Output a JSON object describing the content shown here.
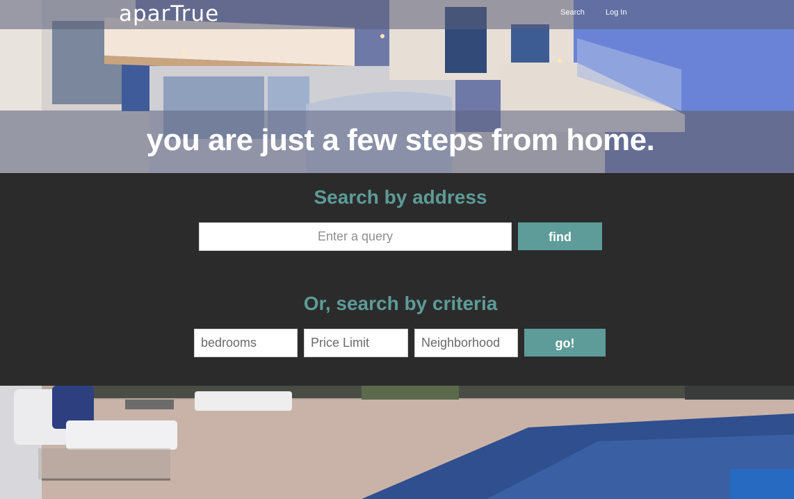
{
  "brand": {
    "logo_text": "aparTrue"
  },
  "nav": {
    "search_label": "Search",
    "login_label": "Log In"
  },
  "hero": {
    "tagline": "you are just a few steps from home."
  },
  "address_search": {
    "title": "Search by address",
    "query_placeholder": "Enter a query",
    "find_label": "find"
  },
  "criteria_search": {
    "title": "Or, search by criteria",
    "bedrooms_placeholder": "bedrooms",
    "price_placeholder": "Price Limit",
    "neighborhood_placeholder": "Neighborhood",
    "go_label": "go!"
  },
  "colors": {
    "accent": "#5d9c98",
    "panel_background": "#2b2b2b",
    "text_light": "#ffffff"
  }
}
